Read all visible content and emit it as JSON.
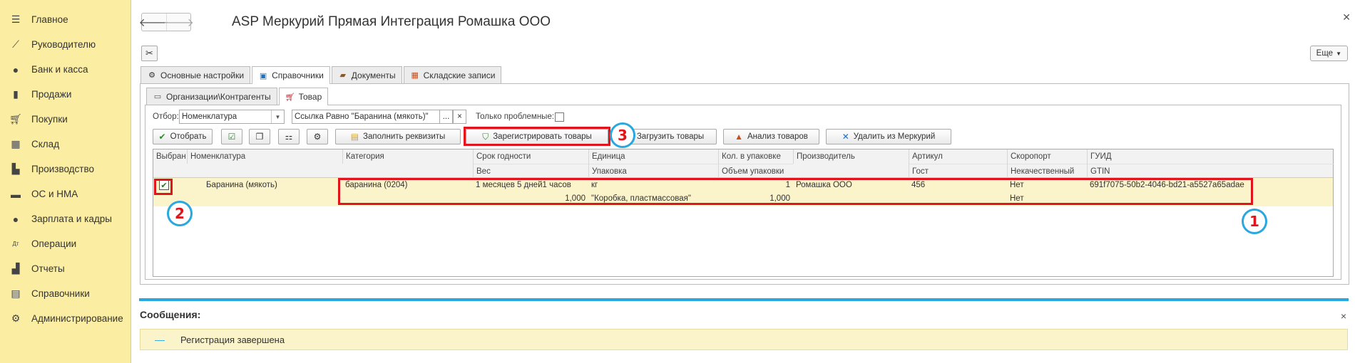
{
  "sidebar": {
    "items": [
      {
        "label": "Главное",
        "icon": "menu-icon"
      },
      {
        "label": "Руководителю",
        "icon": "chart-line-icon"
      },
      {
        "label": "Банк и касса",
        "icon": "coin-icon"
      },
      {
        "label": "Продажи",
        "icon": "bag-icon"
      },
      {
        "label": "Покупки",
        "icon": "cart-icon"
      },
      {
        "label": "Склад",
        "icon": "warehouse-icon"
      },
      {
        "label": "Производство",
        "icon": "factory-icon"
      },
      {
        "label": "ОС и НМА",
        "icon": "truck-icon"
      },
      {
        "label": "Зарплата и кадры",
        "icon": "person-icon"
      },
      {
        "label": "Операции",
        "icon": "debit-credit-icon"
      },
      {
        "label": "Отчеты",
        "icon": "bar-chart-icon"
      },
      {
        "label": "Справочники",
        "icon": "books-icon"
      },
      {
        "label": "Администрирование",
        "icon": "gear-icon"
      }
    ]
  },
  "window": {
    "title": "ASP Меркурий Прямая Интеграция Ромашка ООО",
    "more_label": "Еще"
  },
  "tabs": {
    "main": [
      {
        "label": "Основные настройки"
      },
      {
        "label": "Справочники"
      },
      {
        "label": "Документы"
      },
      {
        "label": "Складские записи"
      }
    ],
    "sub": [
      {
        "label": "Организации\\Контрагенты"
      },
      {
        "label": "Товар"
      }
    ]
  },
  "filter": {
    "label": "Отбор:",
    "field_value": "Номенклатура",
    "condition_value": "Ссылка Равно \"Баранина (мякоть)\"",
    "ellipsis": "...",
    "clear": "×",
    "problem_only_label": "Только проблемные:"
  },
  "commands": {
    "select": "Отобрать",
    "fill": "Заполнить реквизиты",
    "register": "Зарегистрировать товары",
    "load": "Загрузить товары",
    "analyze": "Анализ товаров",
    "delete": "Удалить из Меркурий"
  },
  "grid": {
    "headers_row1": [
      "Выбран",
      "Номенклатура",
      "Категория",
      "Срок годности",
      "Единица",
      "Кол. в упаковке",
      "Производитель",
      "Артикул",
      "Скоропорт",
      "ГУИД"
    ],
    "headers_row2": [
      "Вес",
      "Упаковка",
      "Объем упаковки",
      "Гост",
      "Некачественный",
      "GTIN"
    ],
    "row": {
      "name": "Баранина (мякоть)",
      "category": "баранина (0204)",
      "shelf_life": "1 месяцев 5 дней1 часов",
      "unit": "кг",
      "qty_in_pack": "1",
      "manufacturer": "Ромашка ООО",
      "article": "456",
      "perishable": "Нет",
      "guid": "691f7075-50b2-4046-bd21-a5527a65adae",
      "weight": "1,000",
      "package": "\"Коробка, пластмассовая\"",
      "pack_volume": "1,000",
      "low_quality": "Нет"
    }
  },
  "annotations": {
    "badge1": "1",
    "badge2": "2",
    "badge3": "3"
  },
  "messages": {
    "title": "Сообщения:",
    "text": "Регистрация завершена",
    "close": "×"
  },
  "colors": {
    "sidebar_bg": "#fbeda2",
    "row_highlight": "#fbf3c9",
    "annotation_red": "#e3131b",
    "annotation_blue": "#29a8e0"
  }
}
